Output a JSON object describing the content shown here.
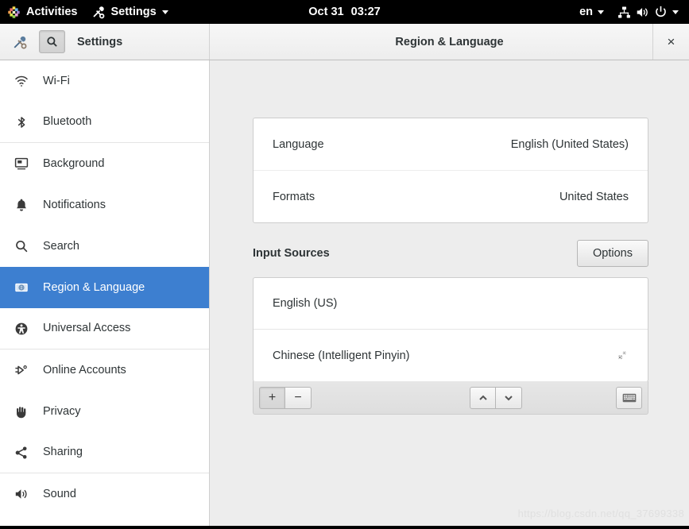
{
  "topbar": {
    "activities": "Activities",
    "app_menu": "Settings",
    "date": "Oct 31",
    "time": "03:27",
    "input_indicator": "en",
    "icons": [
      "network-wired-icon",
      "volume-icon",
      "power-icon",
      "chevron-down-icon"
    ]
  },
  "headerbar": {
    "app_icon": "settings-tools-icon",
    "search_icon": "search-icon",
    "left_title": "Settings",
    "right_title": "Region & Language",
    "close_label": "×"
  },
  "sidebar": {
    "items": [
      {
        "label": "Wi-Fi",
        "icon": "wifi-icon",
        "selected": false,
        "separator_after": false
      },
      {
        "label": "Bluetooth",
        "icon": "bluetooth-icon",
        "selected": false,
        "separator_after": true
      },
      {
        "label": "Background",
        "icon": "background-icon",
        "selected": false,
        "separator_after": false
      },
      {
        "label": "Notifications",
        "icon": "bell-icon",
        "selected": false,
        "separator_after": false
      },
      {
        "label": "Search",
        "icon": "search-icon",
        "selected": false,
        "separator_after": false
      },
      {
        "label": "Region & Language",
        "icon": "region-language-icon",
        "selected": true,
        "separator_after": false
      },
      {
        "label": "Universal Access",
        "icon": "accessibility-icon",
        "selected": false,
        "separator_after": true
      },
      {
        "label": "Online Accounts",
        "icon": "plug-icon",
        "selected": false,
        "separator_after": false
      },
      {
        "label": "Privacy",
        "icon": "hand-icon",
        "selected": false,
        "separator_after": false
      },
      {
        "label": "Sharing",
        "icon": "share-icon",
        "selected": false,
        "separator_after": true
      },
      {
        "label": "Sound",
        "icon": "volume-icon",
        "selected": false,
        "separator_after": false
      }
    ]
  },
  "main": {
    "language_rows": [
      {
        "label": "Language",
        "value": "English (United States)"
      },
      {
        "label": "Formats",
        "value": "United States"
      }
    ],
    "input_sources": {
      "title": "Input Sources",
      "options_label": "Options",
      "rows": [
        {
          "label": "English (US)",
          "has_gear": false
        },
        {
          "label": "Chinese (Intelligent Pinyin)",
          "has_gear": true
        }
      ],
      "toolbar": {
        "add_label": "+",
        "remove_label": "−",
        "move_up_icon": "chevron-up-icon",
        "move_down_icon": "chevron-down-icon",
        "keyboard_icon": "keyboard-layout-icon"
      }
    }
  },
  "watermark": {
    "text": "https://blog.csdn.net/qq_37699338"
  },
  "colors": {
    "selection_blue": "#3d7fd0",
    "panel_bg": "#ededed",
    "list_bg": "#ffffff",
    "topbar_bg": "#000000",
    "text": "#2e3436"
  }
}
